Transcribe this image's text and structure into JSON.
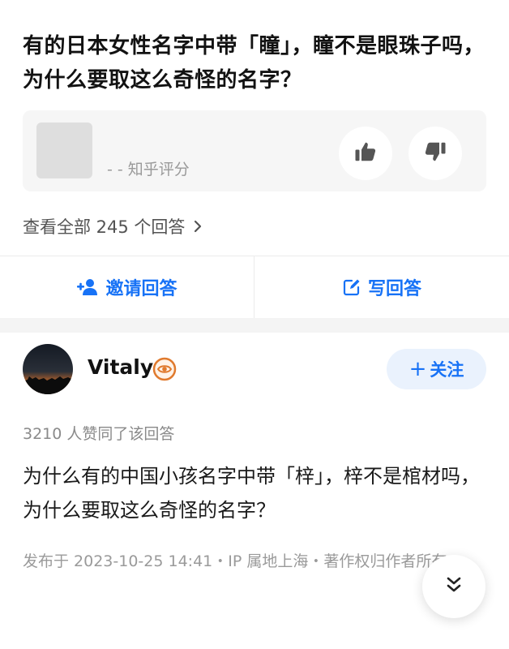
{
  "question": {
    "title": "有的日本女性名字中带「瞳」，瞳不是眼珠子吗，为什么要取这么奇怪的名字？"
  },
  "rating": {
    "label": "- - 知乎评分",
    "upvote_icon": "thumbs-up-icon",
    "downvote_icon": "thumbs-down-icon"
  },
  "answers_link": {
    "label": "查看全部 245 个回答",
    "icon": "chevron-right-icon"
  },
  "actions": {
    "invite_label": "邀请回答",
    "invite_icon": "add-user-icon",
    "write_label": "写回答",
    "write_icon": "edit-icon"
  },
  "author": {
    "name": "Vitaly",
    "badge_icon": "eye-badge-icon",
    "follow_label": "关注",
    "follow_icon": "plus-icon"
  },
  "answer": {
    "vote_summary": "3210 人赞同了该回答",
    "text": "为什么有的中国小孩名字中带「梓」，梓不是棺材吗，为什么要取这么奇怪的名字？",
    "publish_info": "发布于 2023-10-25 14:41・IP 属地上海・著作权归作者所有"
  },
  "fab": {
    "icon": "double-chevron-down-icon"
  },
  "colors": {
    "accent": "#1772f6",
    "badge": "#e07a2e",
    "muted_text": "#9a9a9a"
  }
}
